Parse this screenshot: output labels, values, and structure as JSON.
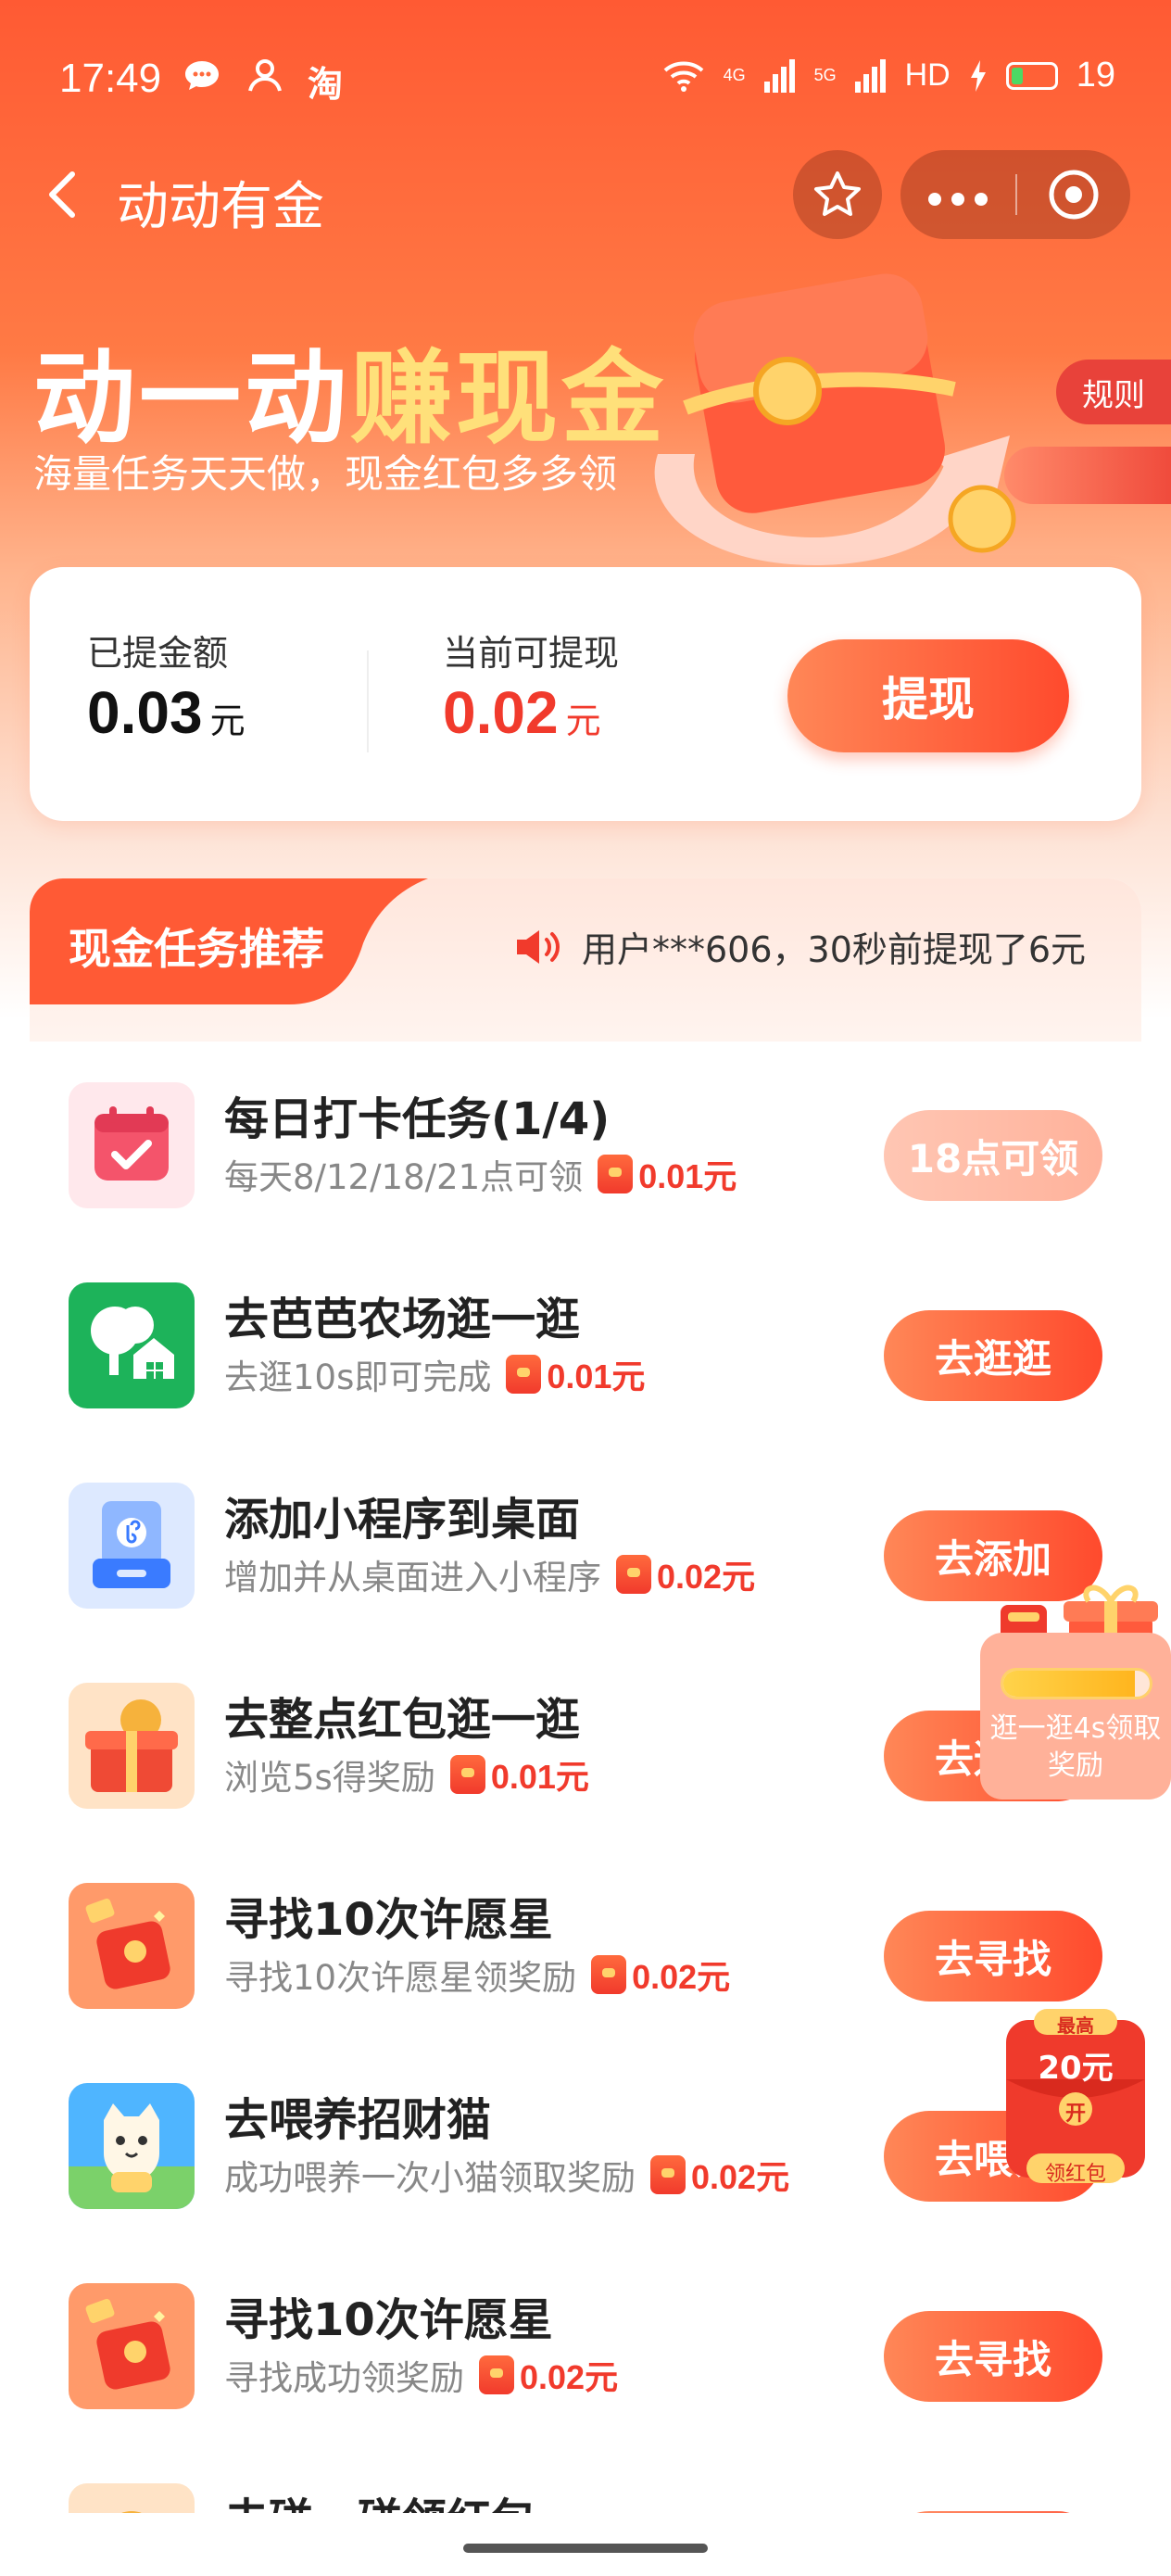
{
  "status_bar": {
    "time": "17:49",
    "left_icons": [
      "message-bubble-icon",
      "user-icon",
      "taobao-icon"
    ],
    "taobao_label": "淘",
    "network_4g": "4G",
    "network_5g": "5G",
    "hd": "HD",
    "battery_level": "19"
  },
  "nav": {
    "title": "动动有金"
  },
  "hero": {
    "title_part1": "动一动",
    "title_part2": "赚现金",
    "subtitle": "海量任务天天做，现金红包多多领",
    "rules_label": "规则"
  },
  "balance": {
    "withdrawn_label": "已提金额",
    "withdrawn_value": "0.03",
    "withdrawn_unit": "元",
    "available_label": "当前可提现",
    "available_value": "0.02",
    "available_unit": "元",
    "withdraw_button": "提现"
  },
  "tasks": {
    "section_title": "现金任务推荐",
    "ticker_text": "用户***606，30秒前提现了6元",
    "items": [
      {
        "title": "每日打卡任务(1/4)",
        "desc": "每天8/12/18/21点可领",
        "reward": "0.01元",
        "button": "18点可领",
        "icon": "calendar-check-icon"
      },
      {
        "title": "去芭芭农场逛一逛",
        "desc": "去逛10s即可完成",
        "reward": "0.01元",
        "button": "去逛逛",
        "icon": "farm-tree-icon"
      },
      {
        "title": "添加小程序到桌面",
        "desc": "增加并从桌面进入小程序",
        "reward": "0.02元",
        "button": "去添加",
        "icon": "mini-program-icon"
      },
      {
        "title": "去整点红包逛一逛",
        "desc": "浏览5s得奖励",
        "reward": "0.01元",
        "button": "去逛逛",
        "icon": "gift-box-icon"
      },
      {
        "title": "寻找10次许愿星",
        "desc": "寻找10次许愿星领奖励",
        "reward": "0.02元",
        "button": "去寻找",
        "icon": "red-envelope-icon"
      },
      {
        "title": "去喂养招财猫",
        "desc": "成功喂养一次小猫领取奖励",
        "reward": "0.02元",
        "button": "去喂养",
        "icon": "lucky-cat-icon"
      },
      {
        "title": "寻找10次许愿星",
        "desc": "寻找成功领奖励",
        "reward": "0.02元",
        "button": "去寻找",
        "icon": "red-envelope-icon"
      },
      {
        "title": "去碰一碰领红包",
        "desc": "",
        "reward": "",
        "button": "",
        "icon": "coin-icon"
      }
    ]
  },
  "floating": {
    "browse_text": "逛一逛4s领取奖励",
    "browse_progress": 0.9,
    "redpack_top": "最高",
    "redpack_amount": "20元",
    "redpack_open": "开",
    "redpack_label": "领红包"
  },
  "colors": {
    "primary": "#ff4a2d",
    "gold": "#ffe07a",
    "reward_red": "#f13a2c"
  }
}
